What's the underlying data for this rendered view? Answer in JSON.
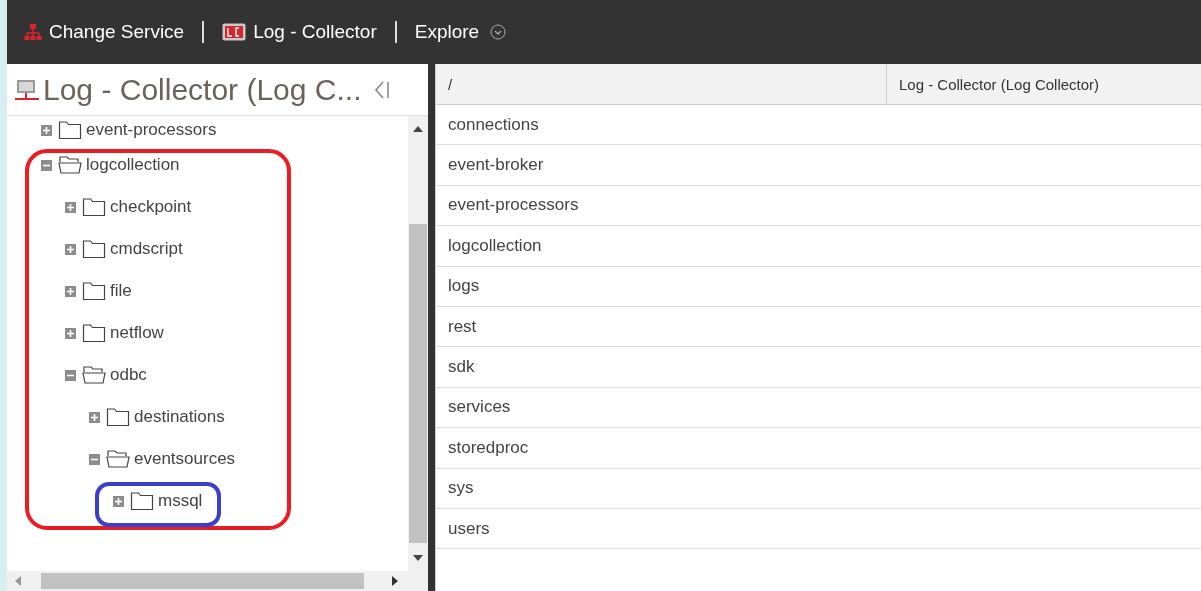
{
  "top_bar": {
    "items": [
      {
        "kind": "service",
        "label": "Change Service"
      },
      {
        "kind": "device",
        "label": "Log - Collector"
      },
      {
        "kind": "menu",
        "label": "Explore"
      }
    ]
  },
  "tree_panel": {
    "title": "Log - Collector (Log C...",
    "tree": [
      {
        "label": "event-processors",
        "expanded": false
      },
      {
        "label": "logcollection",
        "expanded": true,
        "children": [
          {
            "label": "checkpoint",
            "expanded": false
          },
          {
            "label": "cmdscript",
            "expanded": false
          },
          {
            "label": "file",
            "expanded": false
          },
          {
            "label": "netflow",
            "expanded": false
          },
          {
            "label": "odbc",
            "expanded": true,
            "children": [
              {
                "label": "destinations",
                "expanded": false
              },
              {
                "label": "eventsources",
                "expanded": true,
                "children": [
                  {
                    "label": "mssql",
                    "expanded": false
                  }
                ]
              }
            ]
          }
        ]
      }
    ]
  },
  "table": {
    "columns": [
      "/",
      "Log - Collector (Log Collector)"
    ],
    "rows": [
      "connections",
      "event-broker",
      "event-processors",
      "logcollection",
      "logs",
      "rest",
      "sdk",
      "services",
      "storedproc",
      "sys",
      "users"
    ]
  }
}
